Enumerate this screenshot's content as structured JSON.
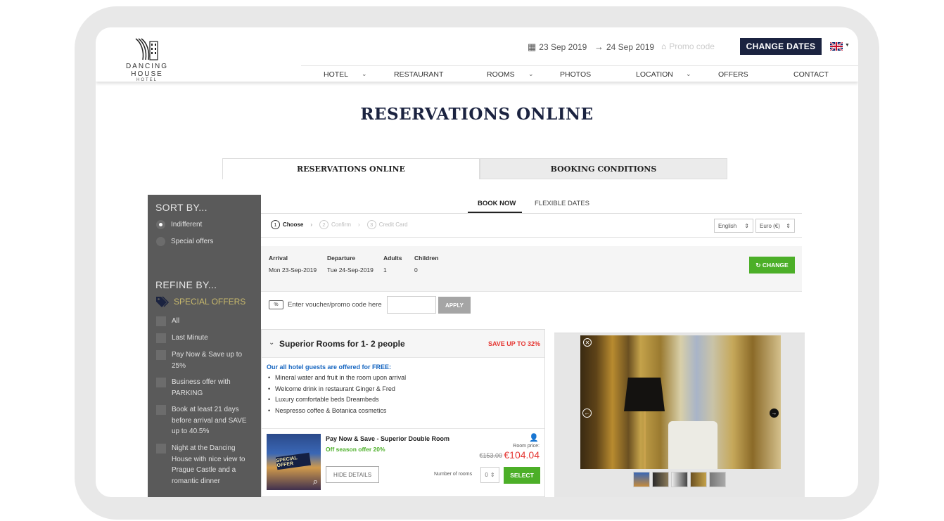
{
  "logo": {
    "line1": "DANCING HOUSE",
    "line2": "HOTEL"
  },
  "header": {
    "arrival_date": "23 Sep 2019",
    "departure_date": "24 Sep 2019",
    "promo_placeholder": "Promo code",
    "change_dates_label": "CHANGE DATES",
    "language_flag": "uk-flag-icon"
  },
  "nav": {
    "items": [
      {
        "label": "HOTEL",
        "dropdown": true
      },
      {
        "label": "RESTAURANT",
        "dropdown": false
      },
      {
        "label": "ROOMS",
        "dropdown": true
      },
      {
        "label": "PHOTOS",
        "dropdown": false
      },
      {
        "label": "LOCATION",
        "dropdown": true
      },
      {
        "label": "OFFERS",
        "dropdown": false
      },
      {
        "label": "CONTACT",
        "dropdown": false
      }
    ]
  },
  "page_title": "RESERVATIONS ONLINE",
  "main_tabs": [
    "RESERVATIONS ONLINE",
    "BOOKING CONDITIONS"
  ],
  "sidebar": {
    "sort_title": "SORT BY...",
    "sort_options": [
      {
        "label": "Indifferent",
        "selected": true
      },
      {
        "label": "Special offers",
        "selected": false
      }
    ],
    "refine_title": "REFINE BY...",
    "special_offers_label": "SPECIAL OFFERS",
    "filters": [
      "All",
      "Last Minute",
      "Pay Now & Save up to 25%",
      "Business offer with PARKING",
      "Book at least 21 days before arrival and SAVE up to 40.5%",
      "Night at the Dancing House with nice view to Prague Castle and a romantic dinner"
    ]
  },
  "booking_tabs": {
    "book_now": "BOOK NOW",
    "flexible_dates": "FLEXIBLE DATES"
  },
  "steps": [
    {
      "num": "1",
      "label": "Choose",
      "active": true
    },
    {
      "num": "2",
      "label": "Confirm",
      "active": false
    },
    {
      "num": "3",
      "label": "Credit Card",
      "active": false
    }
  ],
  "selects": {
    "language": "English",
    "currency": "Euro (€)"
  },
  "summary": {
    "arrival_label": "Arrival",
    "arrival_value": "Mon 23-Sep-2019",
    "departure_label": "Departure",
    "departure_value": "Tue 24-Sep-2019",
    "adults_label": "Adults",
    "adults_value": "1",
    "children_label": "Children",
    "children_value": "0",
    "change_label": "CHANGE"
  },
  "voucher": {
    "icon_text": "%",
    "label": "Enter voucher/promo code here",
    "apply_label": "APPLY"
  },
  "room": {
    "title": "Superior Rooms for 1- 2 people",
    "save_badge": "SAVE UP TO 32%",
    "free_title": "Our all hotel guests are offered for FREE:",
    "free_items": [
      "Mineral water and fruit in the room upon arrival",
      "Welcome drink in restaurant Ginger & Fred",
      "Luxury comfortable beds Dreambeds",
      "Nespresso coffee & Botanica cosmetics"
    ],
    "offer": {
      "thumb_badge": "SPECIAL OFFER",
      "name": "Pay Now & Save - Superior Double Room",
      "subtitle": "Off season offer 20%",
      "price_label": "Room price:",
      "old_price": "€153.00",
      "new_price": "€104.04",
      "hide_details_label": "HIDE DETAILS",
      "rooms_label": "Number of rooms",
      "rooms_value": "0",
      "select_label": "SELECT"
    }
  },
  "colors": {
    "navy": "#1b2340",
    "green": "#4caf28",
    "red": "#e53935",
    "sidebar": "#5a5a5a",
    "gold": "#c8b96c"
  }
}
